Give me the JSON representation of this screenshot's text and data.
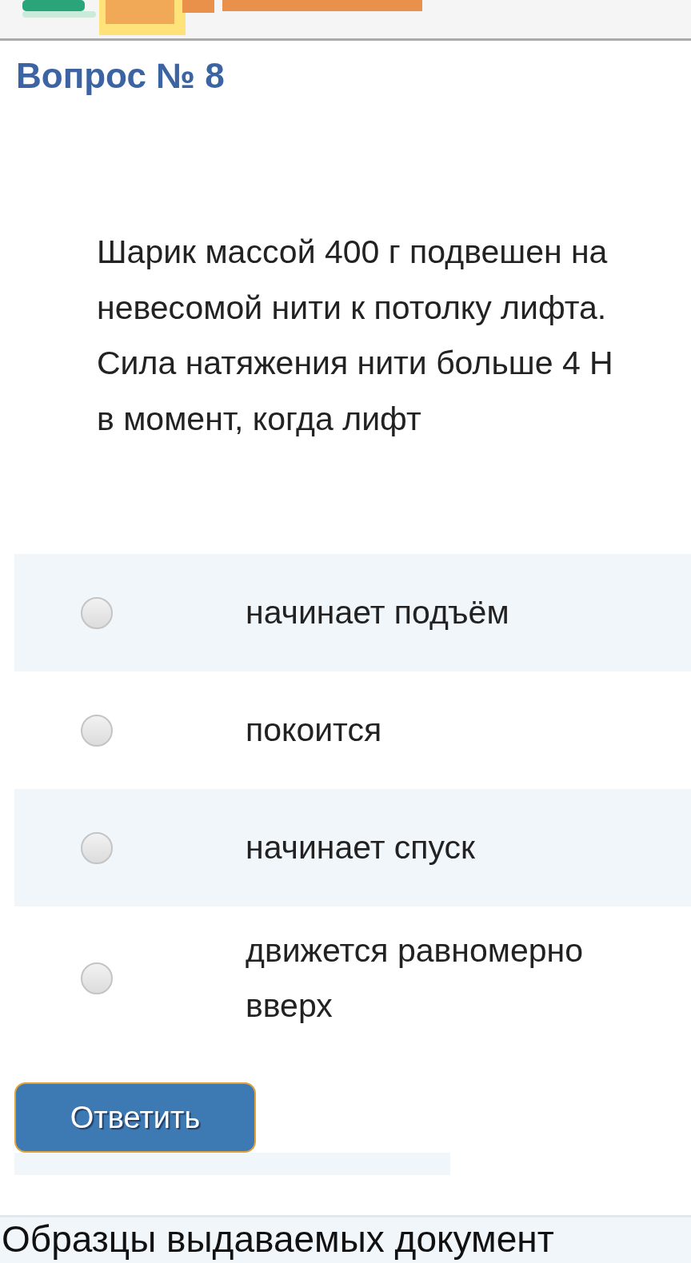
{
  "question": {
    "title": "Вопрос № 8",
    "text": "Шарик массой 400 г подвешен на невесомой нити к потолку лифта. Сила натяжения нити больше 4 Н в момент, когда лифт"
  },
  "options": [
    {
      "label": "начинает подъём",
      "selected": false
    },
    {
      "label": "покоится",
      "selected": false
    },
    {
      "label": "начинает спуск",
      "selected": false
    },
    {
      "label": "движется равномерно вверх",
      "selected": false
    }
  ],
  "submit_button": "Ответить",
  "footer": {
    "heading": "Образцы выдаваемых документ"
  }
}
